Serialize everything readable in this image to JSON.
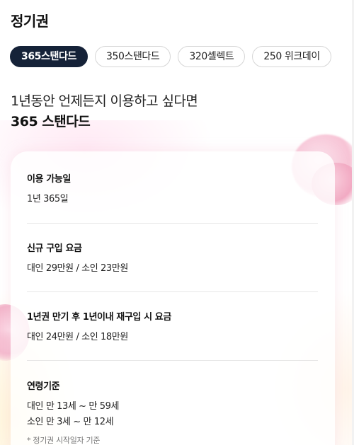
{
  "header": {
    "title": "정기권"
  },
  "tabs": [
    {
      "label": "365스탠다드",
      "active": true
    },
    {
      "label": "350스탠다드",
      "active": false
    },
    {
      "label": "320셀렉트",
      "active": false
    },
    {
      "label": "250 위크데이",
      "active": false
    }
  ],
  "headline": {
    "line1": "1년동안 언제든지 이용하고 싶다면",
    "line2": "365 스탠다드"
  },
  "details": {
    "usable_days": {
      "label": "이용 가능일",
      "value": "1년 365일"
    },
    "new_purchase": {
      "label": "신규 구입 요금",
      "value": "대인 29만원 / 소인 23만원"
    },
    "repurchase": {
      "label": "1년권 만기 후 1년이내 재구입 시 요금",
      "value": "대인 24만원 / 소인 18만원"
    },
    "age_criteria": {
      "label": "연령기준",
      "adult": "대인 만 13세 ~ 만 59세",
      "child": "소인 만 3세 ~ 만 12세",
      "note": "* 정기권 시작일자 기준"
    }
  },
  "colors": {
    "active_tab_bg": "#152238",
    "active_tab_text": "#ffffff",
    "tab_border": "#d6d6d6",
    "accent_pink": "#f7c3d5"
  }
}
